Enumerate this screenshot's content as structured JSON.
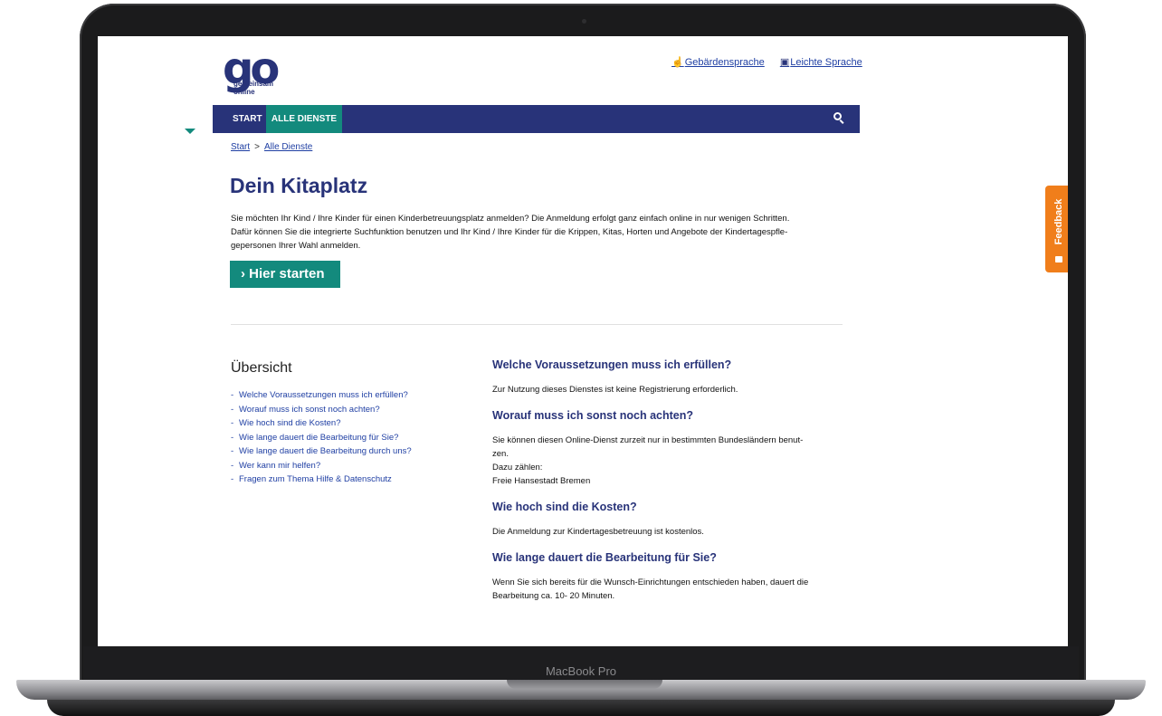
{
  "device": {
    "label": "MacBook Pro"
  },
  "header": {
    "logo_main": "go",
    "logo_sub_line1": "gemeinsam",
    "logo_sub_line2": "online",
    "links": [
      {
        "label": "Gebärdensprache",
        "icon": "sign-language-icon"
      },
      {
        "label": "Leichte Sprache",
        "icon": "easy-language-icon"
      }
    ]
  },
  "nav": {
    "items": [
      {
        "label": "START"
      },
      {
        "label": "ALLE DIENSTE",
        "active": true
      }
    ],
    "search_icon": "search-icon"
  },
  "breadcrumb": {
    "items": [
      "Start",
      "Alle Dienste"
    ],
    "separator": ">"
  },
  "main": {
    "title": "Dein Kitaplatz",
    "intro_lines": [
      "Sie möchten Ihr Kind / Ihre Kinder für einen Kinderbetreuungsplatz anmelden? Die Anmeldung erfolgt ganz einfach online in nur wenigen Schritten.",
      "Dafür können Sie die integrierte Suchfunktion benutzen und Ihr Kind / Ihre Kinder für die Krippen, Kitas, Horten und Angebote der Kindertagespfle-",
      "gepersonen Ihrer Wahl anmelden."
    ],
    "start_button": "› Hier starten"
  },
  "overview": {
    "title": "Übersicht",
    "items": [
      "Welche Voraussetzungen muss ich erfüllen?",
      "Worauf muss ich sonst noch achten?",
      "Wie hoch sind die Kosten?",
      "Wie lange dauert die Bearbeitung für Sie?",
      "Wie lange dauert die Bearbeitung durch uns?",
      "Wer kann mir helfen?",
      "Fragen zum Thema Hilfe & Datenschutz"
    ]
  },
  "sections": [
    {
      "heading": "Welche Voraussetzungen muss ich erfüllen?",
      "lines": [
        "Zur Nutzung dieses Dienstes ist keine Registrierung erforderlich."
      ]
    },
    {
      "heading": "Worauf muss ich sonst noch achten?",
      "lines": [
        "Sie können diesen Online-Dienst zurzeit nur in bestimmten Bundesländern benut-",
        "zen.",
        "Dazu zählen:",
        "Freie Hansestadt Bremen"
      ]
    },
    {
      "heading": "Wie hoch sind die Kosten?",
      "lines": [
        "Die Anmeldung zur Kindertagesbetreuung ist kostenlos."
      ]
    },
    {
      "heading": "Wie lange dauert die Bearbeitung für Sie?",
      "lines": [
        "Wenn Sie sich bereits für die Wunsch-Einrichtungen entschieden haben, dauert die",
        "Bearbeitung ca. 10- 20 Minuten."
      ]
    }
  ],
  "feedback": {
    "label": "Feedback",
    "color": "#f07e1b"
  },
  "colors": {
    "brand_blue": "#283379",
    "brand_teal": "#138a7d",
    "link": "#1f3fa3"
  }
}
